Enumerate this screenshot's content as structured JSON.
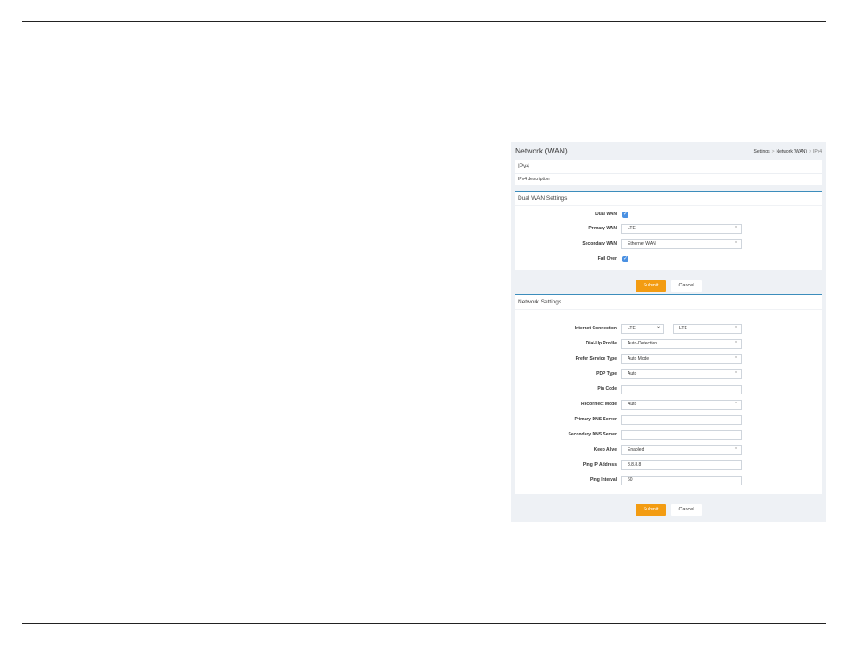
{
  "header": {
    "title": "Network (WAN)",
    "breadcrumb": [
      "Settings",
      "Network (WAN)",
      "IPv4"
    ]
  },
  "ipv4": {
    "title": "IPv4",
    "description": "IPv4 description"
  },
  "dual_wan": {
    "title": "Dual WAN Settings",
    "dual_wan_label": "Dual WAN",
    "dual_wan_checked": true,
    "primary_wan_label": "Primary WAN",
    "primary_wan_value": "LTE",
    "secondary_wan_label": "Secondary WAN",
    "secondary_wan_value": "Ethernet WAN",
    "fail_over_label": "Fail Over",
    "fail_over_checked": true
  },
  "network": {
    "title": "Network Settings",
    "internet_connection_label": "Internet Connection",
    "internet_connection_value": "LTE",
    "internet_connection_value2": "LTE",
    "dialup_profile_label": "Dial-Up Profile",
    "dialup_profile_value": "Auto-Detection",
    "prefer_service_label": "Prefer Service Type",
    "prefer_service_value": "Auto Mode",
    "pdp_type_label": "PDP Type",
    "pdp_type_value": "Auto",
    "pin_code_label": "Pin Code",
    "pin_code_value": "",
    "reconnect_mode_label": "Reconnect Mode",
    "reconnect_mode_value": "Auto",
    "primary_dns_label": "Primary DNS Server",
    "primary_dns_value": "",
    "secondary_dns_label": "Secondary DNS Server",
    "secondary_dns_value": "",
    "keep_alive_label": "Keep Alive",
    "keep_alive_value": "Enabled",
    "ping_ip_label": "Ping IP Address",
    "ping_ip_value": "8.8.8.8",
    "ping_interval_label": "Ping Interval",
    "ping_interval_value": "60"
  },
  "buttons": {
    "submit": "Submit",
    "cancel": "Cancel"
  },
  "colors": {
    "submit": "#f39c12",
    "section_border": "#3c8dbc",
    "checkbox": "#4a90e2"
  }
}
